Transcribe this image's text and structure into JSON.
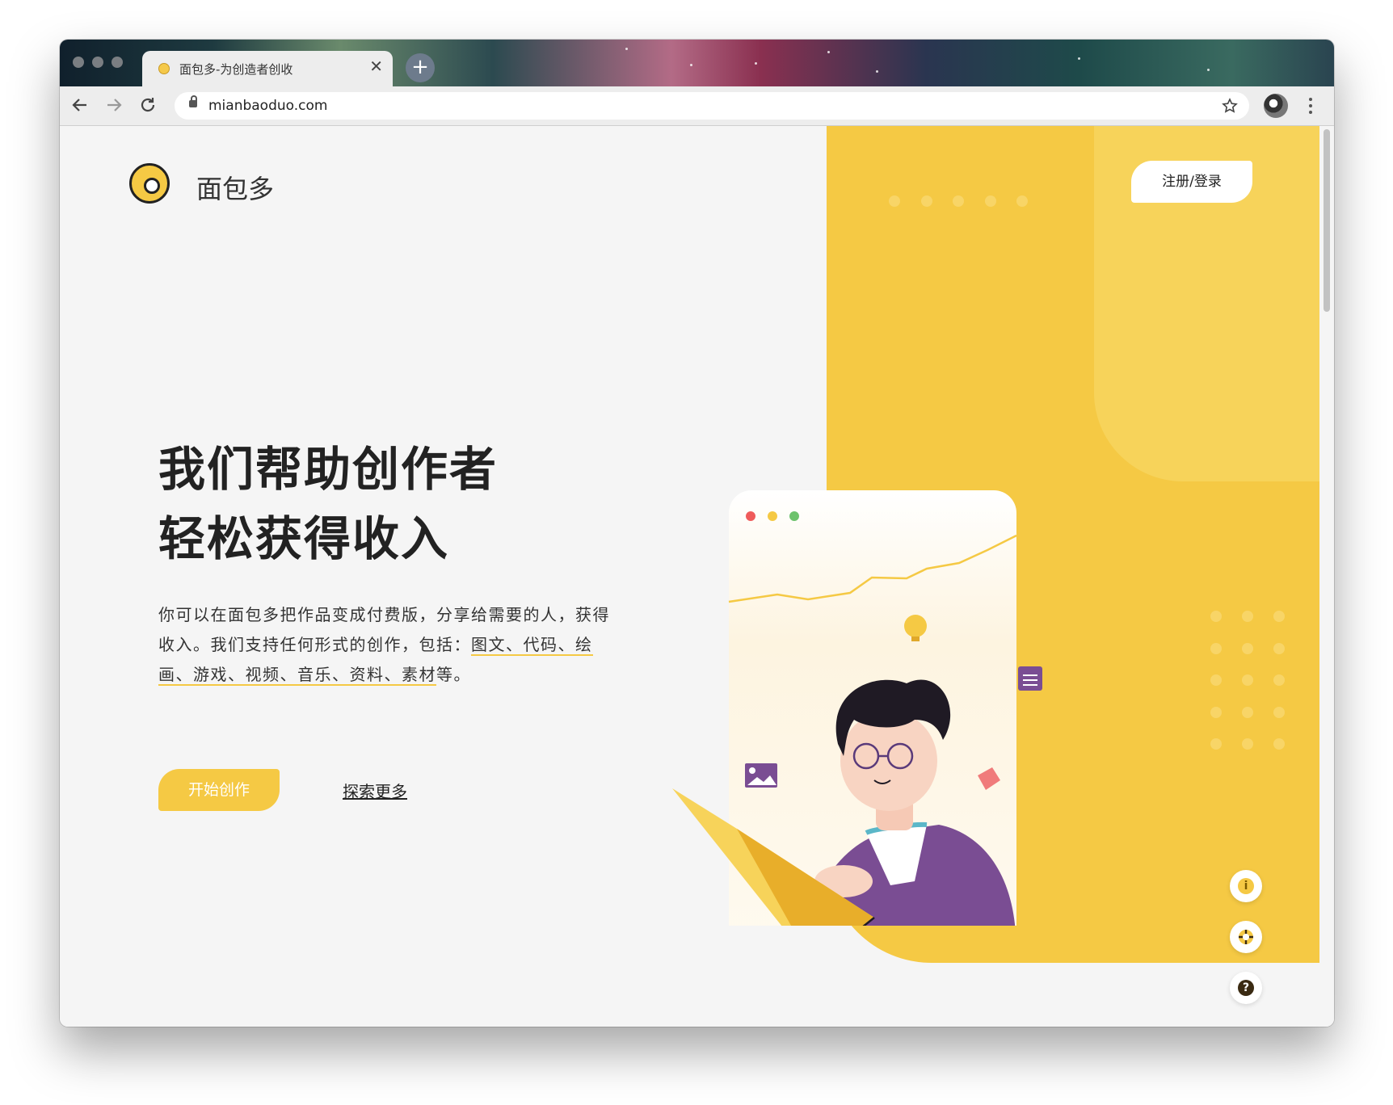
{
  "browser": {
    "tab_title": "面包多-为创造者创收",
    "tab_close": "✕",
    "new_tab": "+",
    "url": "mianbaoduo.com",
    "back_icon": "back-arrow-icon",
    "forward_icon": "forward-arrow-icon",
    "reload_icon": "reload-icon",
    "bookmark_icon": "star-icon",
    "menu_icon": "kebab-menu-icon"
  },
  "header": {
    "brand_name": "面包多",
    "login_label": "注册/登录"
  },
  "hero": {
    "title_line1": "我们帮助创作者",
    "title_line2": "轻松获得收入",
    "description_plain": "你可以在面包多把作品变成付费版，分享给需要的人，获得收入。我们支持任何形式的创作，包括：",
    "description_highlight": "图文、代码、绘画、游戏、视频、音乐、资料、素材",
    "description_end": "等。",
    "start_button": "开始创作",
    "explore_link": "探索更多"
  },
  "side_tools": {
    "info_icon": "lightbulb-info-icon",
    "support_icon": "lifebuoy-icon",
    "help_icon": "question-icon",
    "info_glyph": "i",
    "help_glyph": "?"
  },
  "colors": {
    "accent": "#f5c944",
    "accent_light": "#f7d35a",
    "page_bg": "#f5f5f5",
    "purple": "#7a4d93"
  }
}
